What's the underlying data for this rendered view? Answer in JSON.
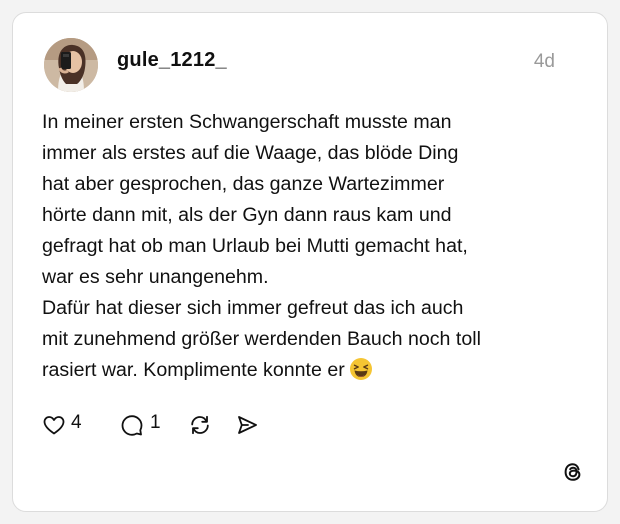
{
  "post": {
    "username": "gule_1212_",
    "timestamp": "4d",
    "lines": [
      "In meiner ersten Schwangerschaft  musste man",
      "immer als erstes auf die Waage,  das blöde Ding",
      "hat aber gesprochen, das ganze Wartezimmer",
      "hörte dann mit, als der Gyn dann raus kam und",
      "gefragt hat ob man Urlaub bei Mutti gemacht hat,",
      "war es sehr unangenehm.",
      "Dafür hat dieser sich immer gefreut das ich auch",
      "mit zunehmend größer werdenden Bauch noch toll",
      "rasiert war. Komplimente konnte er"
    ],
    "emoji": "laughing-squinting-face",
    "likes": "4",
    "replies": "1"
  },
  "icons": {
    "like": "heart-icon",
    "reply": "speech-bubble-icon",
    "repost": "repost-icon",
    "share": "send-icon",
    "brand": "threads-logo"
  },
  "colors": {
    "background": "#f3f3f3",
    "card": "#ffffff",
    "text": "#111111",
    "muted": "#9a9a9a",
    "emoji": "#f5c533"
  }
}
